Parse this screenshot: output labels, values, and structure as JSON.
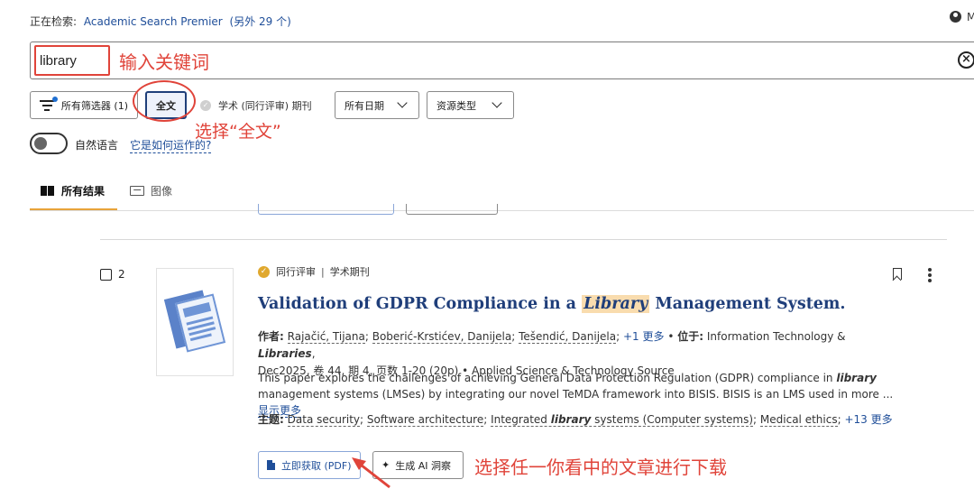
{
  "header": {
    "searching_label": "正在检索:",
    "database": "Academic Search Premier",
    "others": "(另外 29 个)",
    "user_initial": "M"
  },
  "search": {
    "value": "library",
    "placeholder": ""
  },
  "filters": {
    "all_filters": "所有筛选器 (1)",
    "full_text": "全文",
    "peer_reviewed": "学术 (同行评审) 期刊",
    "all_dates": "所有日期",
    "source_type": "资源类型"
  },
  "natural_language": {
    "label": "自然语言",
    "how_link": "它是如何运作的?"
  },
  "tabs": {
    "all_results": "所有结果",
    "images": "图像"
  },
  "annotations": {
    "enter_keyword": "输入关键词",
    "select_full_text": "选择“全文”",
    "select_article": "选择任一你看中的文章进行下载"
  },
  "result": {
    "number": "2",
    "badge": "同行评审",
    "type": "学术期刊",
    "title_before": "Validation of GDPR Compliance in a ",
    "title_highlight": "Library",
    "title_after": " Management System.",
    "authors_label": "作者:",
    "author1": "Rajačić, Tijana",
    "author2": "Boberić-Krstićev, Danijela",
    "author3": "Tešendić, Danijela",
    "more_authors": "+1 更多",
    "located_label": "位于:",
    "source_prefix": "Information Technology & ",
    "source_highlight": "Libraries",
    "source_rest": ",",
    "pub_details": "Dec2025, 卷 44, 期 4, 页数 1-20 (20p) • Applied Science & Technology Source",
    "abstract_before": "This paper explores the challenges of achieving General Data Protection Regulation (GDPR) compliance in ",
    "abstract_highlight": "library",
    "abstract_after": " management systems (LMSes) by integrating our novel TeMDA framework into BISIS. BISIS is an LMS used in more ...",
    "show_more": "显示更多",
    "subjects_label": "主题:",
    "subject1": "Data security",
    "subject2": "Software architecture",
    "subject3_before": "Integrated ",
    "subject3_highlight": "library",
    "subject3_after": " systems (Computer systems)",
    "subject4": "Medical ethics",
    "more_subjects": "+13 更多",
    "get_pdf": "立即获取 (PDF)",
    "ai_insight": "生成 AI 洞察"
  },
  "colors": {
    "accent_blue": "#1f4e99",
    "title_blue": "#1f3e7a",
    "annotation_red": "#e0443a",
    "tab_underline": "#e8a33a",
    "highlight": "#f9dcae"
  }
}
